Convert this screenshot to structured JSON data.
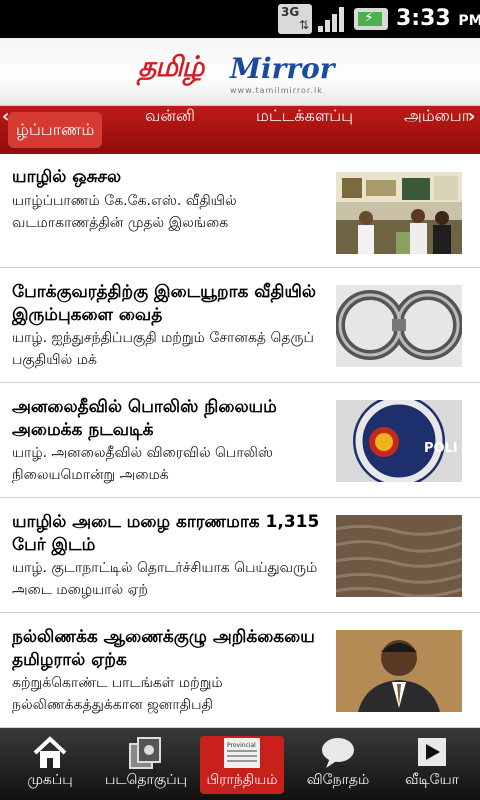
{
  "status_bar": {
    "network": "3G",
    "time": "3:33",
    "ampm": "PM",
    "icons": [
      "3g-data-icon",
      "signal-icon",
      "battery-charging-icon"
    ]
  },
  "header": {
    "logo_tamil": "தமிழ்",
    "logo_mirror": "Mirror",
    "logo_url": "www.tamilmirror.lk",
    "brand_colors": {
      "red": "#d31c24",
      "blue": "#1b4b9c"
    }
  },
  "tabs": {
    "left_arrow": "‹",
    "right_arrow": "›",
    "items": [
      {
        "label": "ழ்ப்பாணம்",
        "active": true
      },
      {
        "label": "வன்னி",
        "active": false
      },
      {
        "label": "மட்டக்களப்பு",
        "active": false
      },
      {
        "label": "அம்பாை",
        "active": false
      }
    ]
  },
  "news": [
    {
      "headline": "யாழில் ஒசுசல",
      "summary": "யாழ்ப்பாணம் கே.கே.எஸ். வீதியில் வடமாகாணத்தின் முதல் இலங்கை",
      "thumb": "pharmacy-photo"
    },
    {
      "headline": "போக்குவரத்திற்கு இடையூறாக வீதியில் இரும்புகளை வைத்",
      "summary": "யாழ். ஐந்துசந்திப்பகுதி மற்றும் சோனகத் தெருப் பகுதியில் மக்",
      "thumb": "handcuffs-photo"
    },
    {
      "headline": "அனலைதீவில் பொலிஸ் நிலையம் அமைக்க நடவடிக்",
      "summary": "யாழ். அனலைதீவில் விரைவில் பொலிஸ் நிலையமொன்று அமைக்",
      "thumb": "police-badge-photo"
    },
    {
      "headline": "யாழில் அடை மழை காரணமாக 1,315 பேர் இடம்",
      "summary": "யாழ். குடாநாட்டில் தொடர்ச்சியாக பெய்துவரும் அடை மழையால் ஏற்",
      "thumb": "rain-water-photo"
    },
    {
      "headline": "நல்லிணக்க ஆணைக்குழு அறிக்கையை தமிழரால் ஏற்க",
      "summary": "கற்றுக்கொண்ட பாடங்கள் மற்றும் நல்லிணக்கத்துக்கான ஜனாதிபதி",
      "thumb": "portrait-photo"
    }
  ],
  "bottom_nav": [
    {
      "label": "முகப்பு",
      "icon": "home-icon",
      "active": false
    },
    {
      "label": "படதொகுப்பு",
      "icon": "photo-gallery-icon",
      "active": false
    },
    {
      "label": "பிராந்தியம்",
      "icon": "provincial-news-icon",
      "active": true
    },
    {
      "label": "விநோதம்",
      "icon": "speech-bubble-icon",
      "active": false
    },
    {
      "label": "வீடியோ",
      "icon": "video-play-icon",
      "active": false
    }
  ],
  "thumb_icon_text": {
    "provincial": "Provincial"
  }
}
